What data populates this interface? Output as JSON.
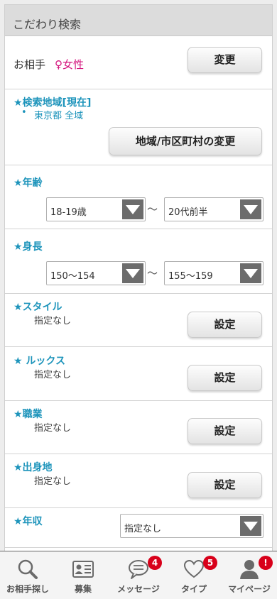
{
  "header": {
    "title": "こだわり検索"
  },
  "partner": {
    "label": "お相手",
    "value": "♀女性",
    "button": "変更"
  },
  "area": {
    "label": "★検索地域[現在]",
    "bullet": "•",
    "current": "東京都 全域",
    "button": "地域/市区町村の変更"
  },
  "age": {
    "label": "★年齢",
    "from": "18-19歳",
    "sep": "～",
    "to": "20代前半"
  },
  "height": {
    "label": "★身長",
    "from": "150～154",
    "sep": "～",
    "to": "155～159"
  },
  "style": {
    "label": "★スタイル",
    "value": "指定なし",
    "button": "設定"
  },
  "looks": {
    "label": "★ ルックス",
    "value": "指定なし",
    "button": "設定"
  },
  "job": {
    "label": "★職業",
    "value": "指定なし",
    "button": "設定"
  },
  "hometown": {
    "label": "★出身地",
    "value": "指定なし",
    "button": "設定"
  },
  "income": {
    "label": "★年収",
    "value": "指定なし"
  },
  "nav": {
    "items": [
      {
        "label": "お相手探し",
        "icon": "search-icon"
      },
      {
        "label": "募集",
        "icon": "profile-card-icon"
      },
      {
        "label": "メッセージ",
        "icon": "chat-bubble-icon",
        "badge": "4"
      },
      {
        "label": "タイプ",
        "icon": "heart-icon",
        "badge": "5"
      },
      {
        "label": "マイページ",
        "icon": "user-icon",
        "badge": "!"
      }
    ]
  },
  "colors": {
    "accent": "#1d94bb",
    "female": "#d4157e",
    "badge": "#d8001a"
  }
}
